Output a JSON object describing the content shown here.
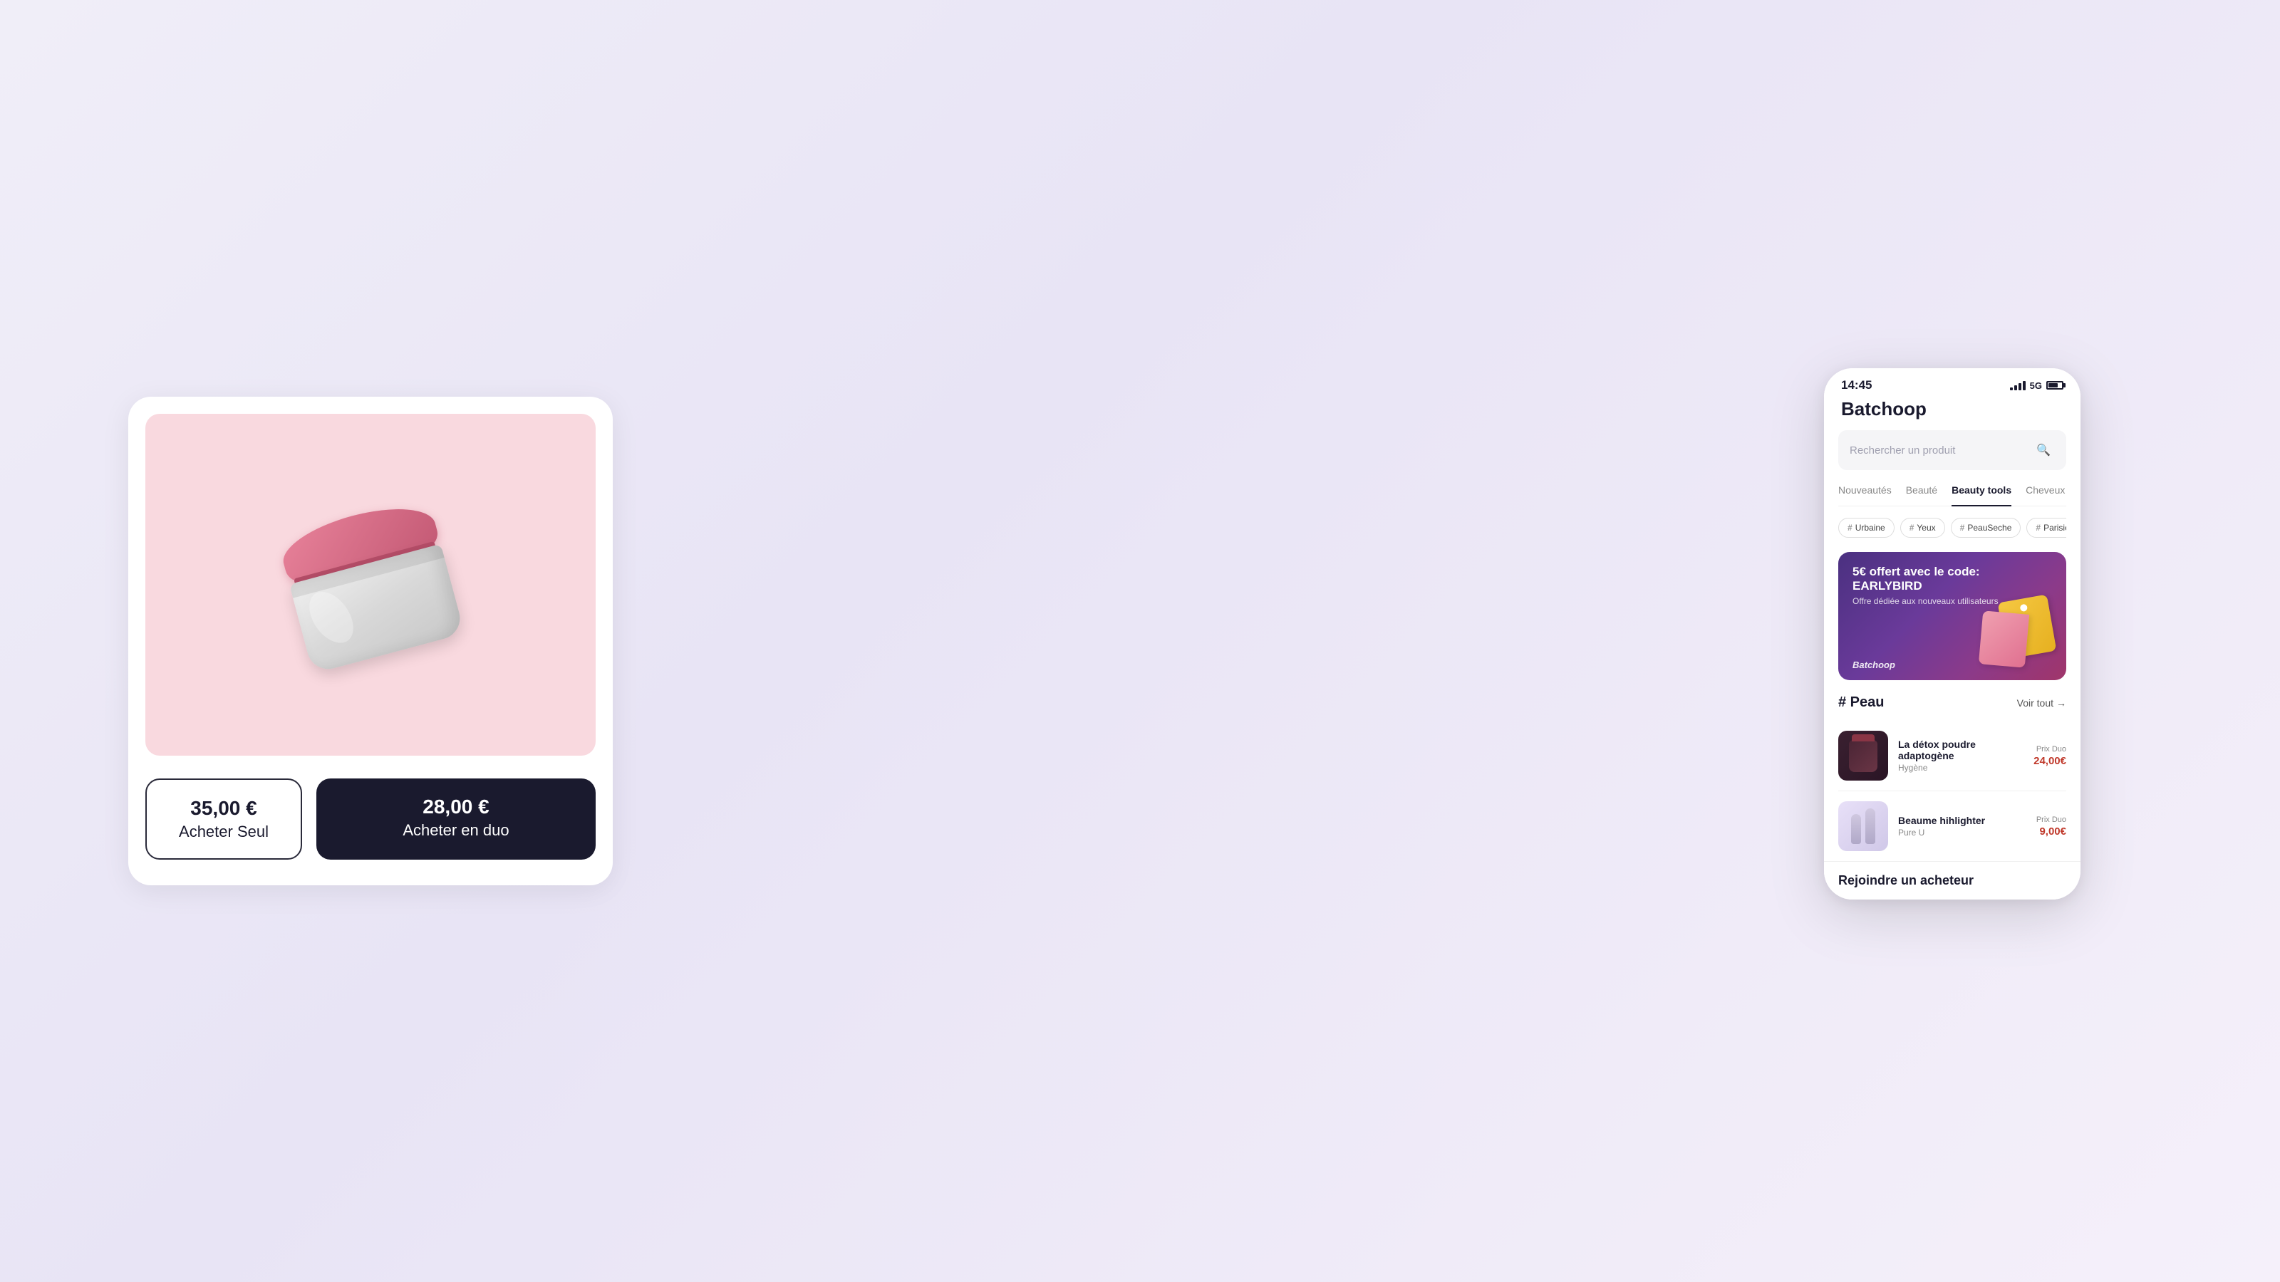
{
  "background": {
    "gradient": "linear-gradient(135deg, #f0eef8, #e8e4f5, #f5f0fa)"
  },
  "product_card": {
    "price_single": "35,00 €",
    "label_single": "Acheter Seul",
    "price_duo": "28,00 €",
    "label_duo": "Acheter en duo"
  },
  "phone": {
    "status_bar": {
      "time": "14:45",
      "network": "5G"
    },
    "app_title": "Batchoop",
    "search_placeholder": "Rechercher un produit",
    "nav_tabs": [
      {
        "label": "Nouveautés",
        "active": false
      },
      {
        "label": "Beauté",
        "active": false
      },
      {
        "label": "Beauty tools",
        "active": true
      },
      {
        "label": "Cheveux",
        "active": false
      }
    ],
    "hashtag_pills": [
      {
        "tag": "Urbaine"
      },
      {
        "tag": "Yeux"
      },
      {
        "tag": "PeauSeche"
      },
      {
        "tag": "Parisienne"
      }
    ],
    "promo_banner": {
      "title": "5€ offert avec le code: EARLYBIRD",
      "subtitle": "Offre dédiée aux nouveaux utilisateurs",
      "brand": "Batchoop"
    },
    "peau_section": {
      "title": "# Peau",
      "voir_tout": "Voir tout"
    },
    "products": [
      {
        "name": "La détox poudre adaptogène",
        "category": "Hygène",
        "prix_duo_label": "Prix Duo",
        "price": "24,00€"
      },
      {
        "name": "Beaume hihlighter",
        "category": "Pure U",
        "prix_duo_label": "Prix Duo",
        "price": "9,00€"
      }
    ],
    "rejoindre": {
      "title": "Rejoindre un acheteur"
    }
  }
}
